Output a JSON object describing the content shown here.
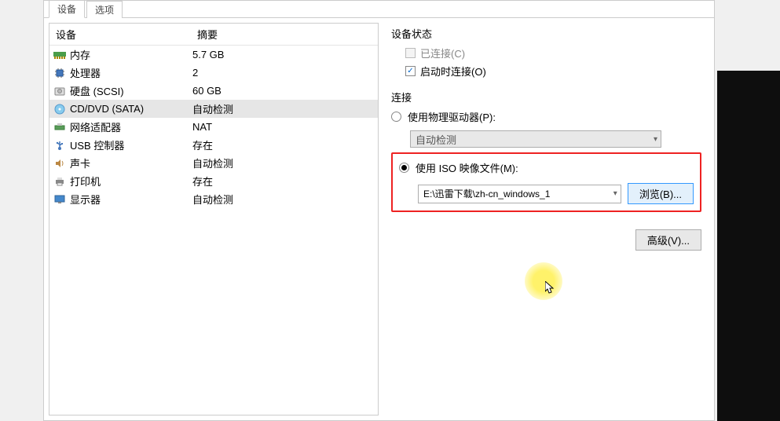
{
  "tabs": {
    "t0": "设备",
    "t1": "选项"
  },
  "device_table": {
    "header_device": "设备",
    "header_summary": "摘要",
    "rows": [
      {
        "name": "内存",
        "summary": "5.7 GB",
        "icon": "memory-icon"
      },
      {
        "name": "处理器",
        "summary": "2",
        "icon": "cpu-icon"
      },
      {
        "name": "硬盘 (SCSI)",
        "summary": "60 GB",
        "icon": "hdd-icon"
      },
      {
        "name": "CD/DVD (SATA)",
        "summary": "自动检测",
        "icon": "cd-icon"
      },
      {
        "name": "网络适配器",
        "summary": "NAT",
        "icon": "network-icon"
      },
      {
        "name": "USB 控制器",
        "summary": "存在",
        "icon": "usb-icon"
      },
      {
        "name": "声卡",
        "summary": "自动检测",
        "icon": "sound-icon"
      },
      {
        "name": "打印机",
        "summary": "存在",
        "icon": "printer-icon"
      },
      {
        "name": "显示器",
        "summary": "自动检测",
        "icon": "display-icon"
      }
    ]
  },
  "status_group": {
    "title": "设备状态",
    "connected_label": "已连接(C)",
    "connect_at_poweron_label": "启动时连接(O)"
  },
  "connection_group": {
    "title": "连接",
    "use_physical_label": "使用物理驱动器(P):",
    "physical_combo_value": "自动检测",
    "use_iso_label": "使用 ISO 映像文件(M):",
    "iso_path": "E:\\迅雷下载\\zh-cn_windows_1",
    "browse_label": "浏览(B)..."
  },
  "advanced_label": "高级(V)..."
}
